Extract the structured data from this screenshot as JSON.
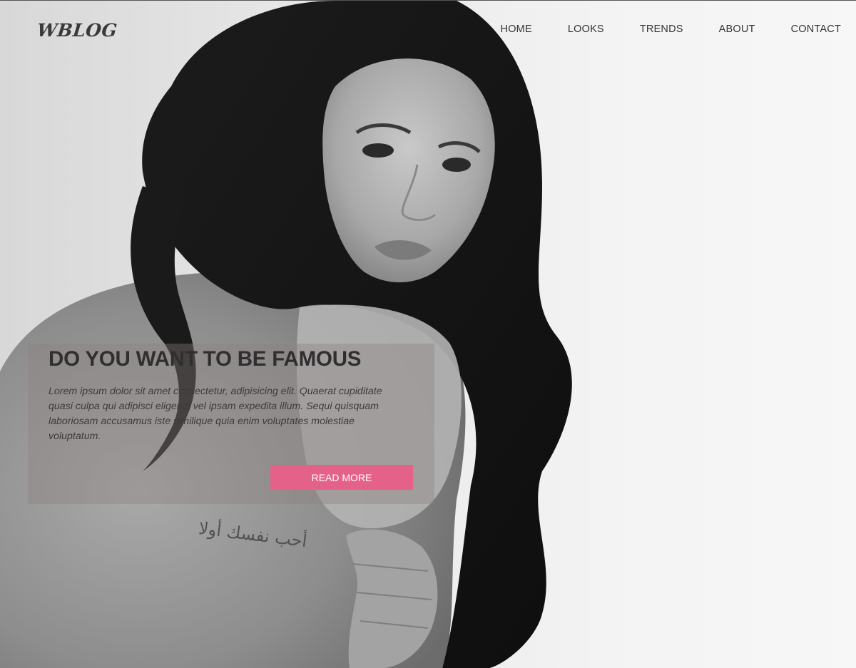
{
  "header": {
    "logo": "WBLOG",
    "nav": [
      {
        "label": "HOME"
      },
      {
        "label": "LOOKS"
      },
      {
        "label": "TRENDS"
      },
      {
        "label": "ABOUT"
      },
      {
        "label": "CONTACT"
      }
    ]
  },
  "hero": {
    "title": "DO YOU WANT TO BE FAMOUS",
    "text": "Lorem ipsum dolor sit amet consectetur, adipisicing elit. Quaerat cupiditate quasi culpa qui adipisci eligendi vel ipsam expedita illum. Sequi quisquam laboriosam accusamus iste similique quia enim voluptates molestiae voluptatum.",
    "button_label": "READ MORE",
    "button_color": "#e4628a",
    "tattoo_text": "أحب نفسك أولا"
  }
}
